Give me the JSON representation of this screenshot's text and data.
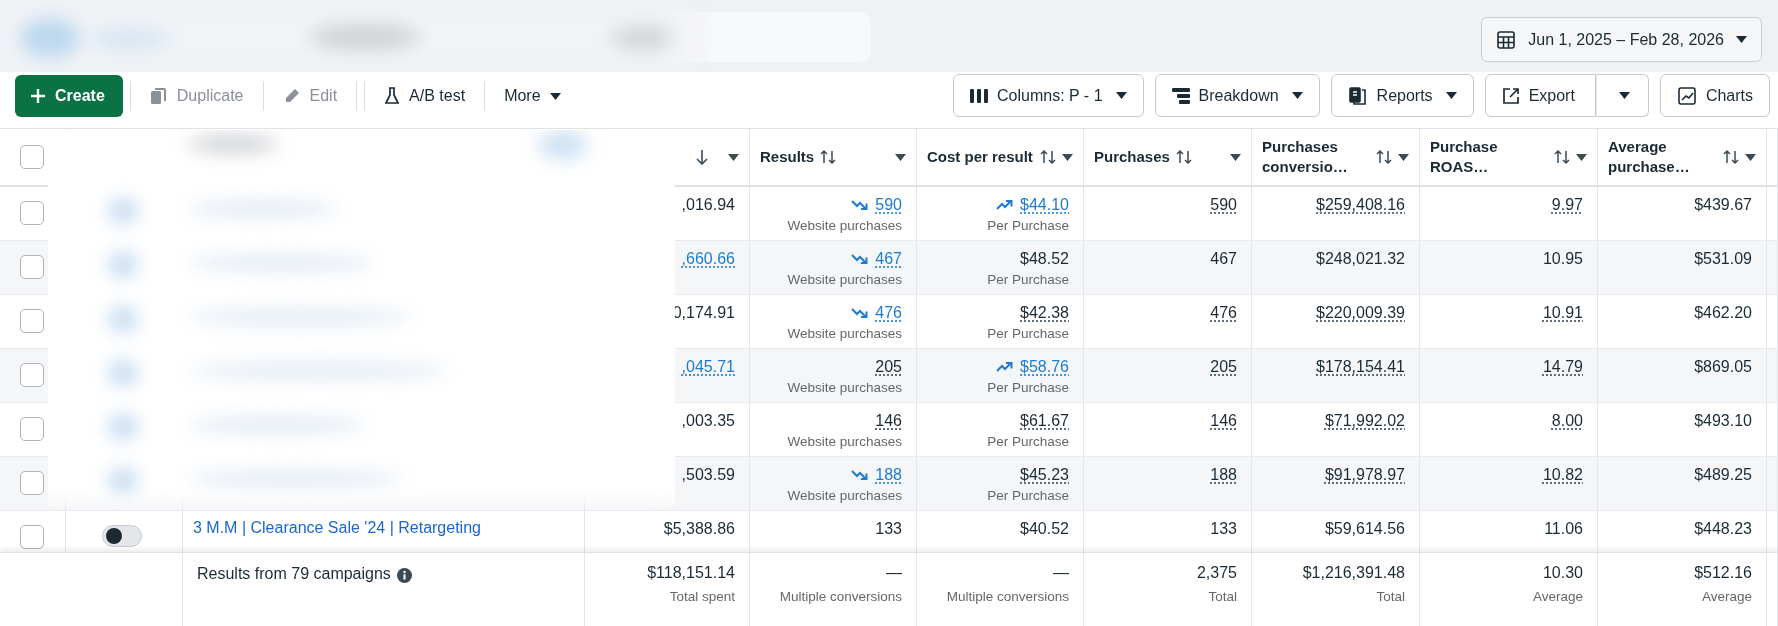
{
  "date_range": {
    "label": "Jun 1, 2025 – Feb 28, 2026"
  },
  "actions": [
    {
      "label": "Create",
      "kind": "create",
      "disabled": false
    },
    {
      "label": "Duplicate",
      "kind": "duplicate",
      "disabled": true
    },
    {
      "label": "Edit",
      "kind": "edit",
      "disabled": true
    },
    {
      "label": "A/B test",
      "kind": "abtest",
      "disabled": false
    },
    {
      "label": "More",
      "kind": "more",
      "disabled": false
    }
  ],
  "view_buttons": [
    {
      "label": "Columns: P - 1",
      "kind": "columns"
    },
    {
      "label": "Breakdown",
      "kind": "breakdown"
    },
    {
      "label": "Reports",
      "kind": "reports"
    },
    {
      "label": "Export",
      "kind": "export"
    },
    {
      "label": "Charts",
      "kind": "charts"
    }
  ],
  "table": {
    "select_all": {
      "checked": false
    },
    "columns": [
      {
        "kind": "sort_only"
      },
      {
        "kind": "sortable",
        "label": "Results"
      },
      {
        "kind": "sortable",
        "label": "Cost per result"
      },
      {
        "kind": "sortable",
        "label": "Purchases"
      },
      {
        "kind": "sortable",
        "label": "Purchases conversio…"
      },
      {
        "kind": "sortable",
        "label": "Purchase ROAS…"
      },
      {
        "kind": "sortable",
        "label": "Average purchase…"
      }
    ],
    "rows": [
      {
        "checked": false,
        "cells": [
          {
            "text": ",016.94",
            "kind": "plain"
          },
          {
            "text": "590",
            "kind": "link_down",
            "label": "Website purchases"
          },
          {
            "text": "$44.10",
            "kind": "link_up",
            "label": "Per Purchase"
          },
          {
            "text": "590",
            "kind": "dotted"
          },
          {
            "text": "$259,408.16",
            "kind": "dotted"
          },
          {
            "text": "9.97",
            "kind": "dotted"
          },
          {
            "text": "$439.67",
            "kind": "plain"
          }
        ]
      },
      {
        "checked": false,
        "cells": [
          {
            "text": ",660.66",
            "kind": "link"
          },
          {
            "text": "467",
            "kind": "link_down",
            "label": "Website purchases"
          },
          {
            "text": "$48.52",
            "kind": "plain",
            "label": "Per Purchase"
          },
          {
            "text": "467",
            "kind": "plain"
          },
          {
            "text": "$248,021.32",
            "kind": "plain"
          },
          {
            "text": "10.95",
            "kind": "plain"
          },
          {
            "text": "$531.09",
            "kind": "plain"
          }
        ]
      },
      {
        "checked": false,
        "cells": [
          {
            "text": "0,174.91",
            "kind": "plain"
          },
          {
            "text": "476",
            "kind": "link_down",
            "label": "Website purchases"
          },
          {
            "text": "$42.38",
            "kind": "dotted",
            "label": "Per Purchase"
          },
          {
            "text": "476",
            "kind": "dotted"
          },
          {
            "text": "$220,009.39",
            "kind": "dotted"
          },
          {
            "text": "10.91",
            "kind": "dotted"
          },
          {
            "text": "$462.20",
            "kind": "plain"
          }
        ]
      },
      {
        "checked": false,
        "cells": [
          {
            "text": ",045.71",
            "kind": "link"
          },
          {
            "text": "205",
            "kind": "dotted",
            "label": "Website purchases"
          },
          {
            "text": "$58.76",
            "kind": "link_up",
            "label": "Per Purchase"
          },
          {
            "text": "205",
            "kind": "dotted"
          },
          {
            "text": "$178,154.41",
            "kind": "dotted"
          },
          {
            "text": "14.79",
            "kind": "dotted"
          },
          {
            "text": "$869.05",
            "kind": "plain"
          }
        ]
      },
      {
        "checked": false,
        "cells": [
          {
            "text": ",003.35",
            "kind": "plain"
          },
          {
            "text": "146",
            "kind": "dotted",
            "label": "Website purchases"
          },
          {
            "text": "$61.67",
            "kind": "dotted",
            "label": "Per Purchase"
          },
          {
            "text": "146",
            "kind": "dotted"
          },
          {
            "text": "$71,992.02",
            "kind": "dotted"
          },
          {
            "text": "8.00",
            "kind": "dotted"
          },
          {
            "text": "$493.10",
            "kind": "plain"
          }
        ]
      },
      {
        "checked": false,
        "cells": [
          {
            "text": ",503.59",
            "kind": "plain"
          },
          {
            "text": "188",
            "kind": "link_down",
            "label": "Website purchases"
          },
          {
            "text": "$45.23",
            "kind": "dotted",
            "label": "Per Purchase"
          },
          {
            "text": "188",
            "kind": "dotted"
          },
          {
            "text": "$91,978.97",
            "kind": "dotted"
          },
          {
            "text": "10.82",
            "kind": "dotted"
          },
          {
            "text": "$489.25",
            "kind": "plain"
          }
        ]
      },
      {
        "checked": false,
        "on": false,
        "name": "3 M.M | Clearance Sale '24 | Retargeting",
        "cells": [
          {
            "text": "$5,388.86",
            "kind": "plain"
          },
          {
            "text": "133",
            "kind": "plain"
          },
          {
            "text": "$40.52",
            "kind": "plain"
          },
          {
            "text": "133",
            "kind": "plain"
          },
          {
            "text": "$59,614.56",
            "kind": "plain"
          },
          {
            "text": "11.06",
            "kind": "plain"
          },
          {
            "text": "$448.23",
            "kind": "plain"
          }
        ]
      }
    ],
    "footer": {
      "summary": "Results from 79 campaigns",
      "totals": [
        {
          "value": "$118,151.14",
          "label": "Total spent"
        },
        {
          "value": "—",
          "label": "Multiple conversions"
        },
        {
          "value": "—",
          "label": "Multiple conversions"
        },
        {
          "value": "2,375",
          "label": "Total"
        },
        {
          "value": "$1,216,391.48",
          "label": "Total"
        },
        {
          "value": "10.30",
          "label": "Average"
        },
        {
          "value": "$512.16",
          "label": "Average"
        }
      ]
    }
  }
}
